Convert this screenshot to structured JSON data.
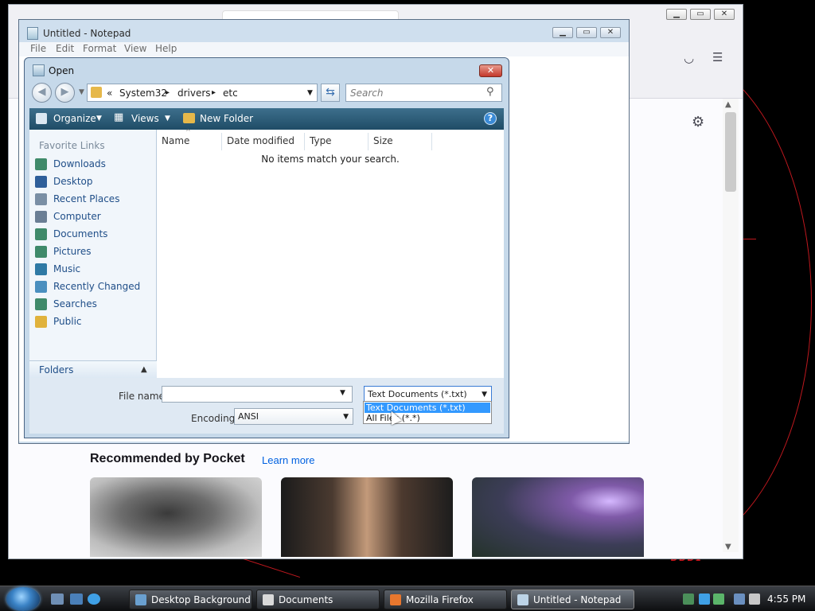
{
  "firefox": {
    "pocket_title": "Recommended by Pocket",
    "pocket_link": "Learn more",
    "win_minimize": "▁",
    "win_maximize": "▭",
    "win_close": "✕"
  },
  "notepad": {
    "title": "Untitled - Notepad",
    "menu": [
      "File",
      "Edit",
      "Format",
      "View",
      "Help"
    ]
  },
  "dialog": {
    "title": "Open",
    "close_glyph": "✕",
    "breadcrumb": [
      "«",
      "System32",
      "▸",
      "drivers",
      "▸",
      "etc"
    ],
    "search_placeholder": "Search",
    "toolbar": {
      "organize": "Organize",
      "views": "Views",
      "new_folder": "New Folder",
      "help": "?"
    },
    "favorite_links_heading": "Favorite Links",
    "favorite_links": [
      {
        "label": "Downloads",
        "icon": "downloads-icon",
        "color": "#3f8a6a"
      },
      {
        "label": "Desktop",
        "icon": "desktop-icon",
        "color": "#2f5f9a"
      },
      {
        "label": "Recent Places",
        "icon": "recent-places-icon",
        "color": "#7a8fa5"
      },
      {
        "label": "Computer",
        "icon": "computer-icon",
        "color": "#6a7e94"
      },
      {
        "label": "Documents",
        "icon": "documents-icon",
        "color": "#3f8a6a"
      },
      {
        "label": "Pictures",
        "icon": "pictures-icon",
        "color": "#3f8a6a"
      },
      {
        "label": "Music",
        "icon": "music-icon",
        "color": "#2f7aa5"
      },
      {
        "label": "Recently Changed",
        "icon": "recently-changed-icon",
        "color": "#4a8fbf"
      },
      {
        "label": "Searches",
        "icon": "searches-icon",
        "color": "#3f8a6a"
      },
      {
        "label": "Public",
        "icon": "public-folder-icon",
        "color": "#e0b23c"
      }
    ],
    "folders_label": "Folders",
    "columns": [
      "Name",
      "Date modified",
      "Type",
      "Size"
    ],
    "empty_message": "No items match your search.",
    "file_name_label": "File name:",
    "file_name_value": "",
    "encoding_label": "Encoding:",
    "encoding_value": "ANSI",
    "file_type_selected": "Text Documents (*.txt)",
    "file_type_options": [
      "Text Documents (*.txt)",
      "All Files (*.*)"
    ]
  },
  "taskbar": {
    "buttons": [
      {
        "label": "Desktop Background",
        "icon": "desktop-background-icon",
        "active": false
      },
      {
        "label": "Documents",
        "icon": "documents-folder-icon",
        "active": false
      },
      {
        "label": "Mozilla Firefox",
        "icon": "firefox-icon",
        "active": false
      },
      {
        "label": "Untitled - Notepad",
        "icon": "notepad-icon",
        "active": true
      }
    ],
    "clock": "4:55 PM"
  },
  "colors": {
    "selection": "#3399ff",
    "link": "#1f4e88",
    "toolbar": "#2a5975"
  }
}
